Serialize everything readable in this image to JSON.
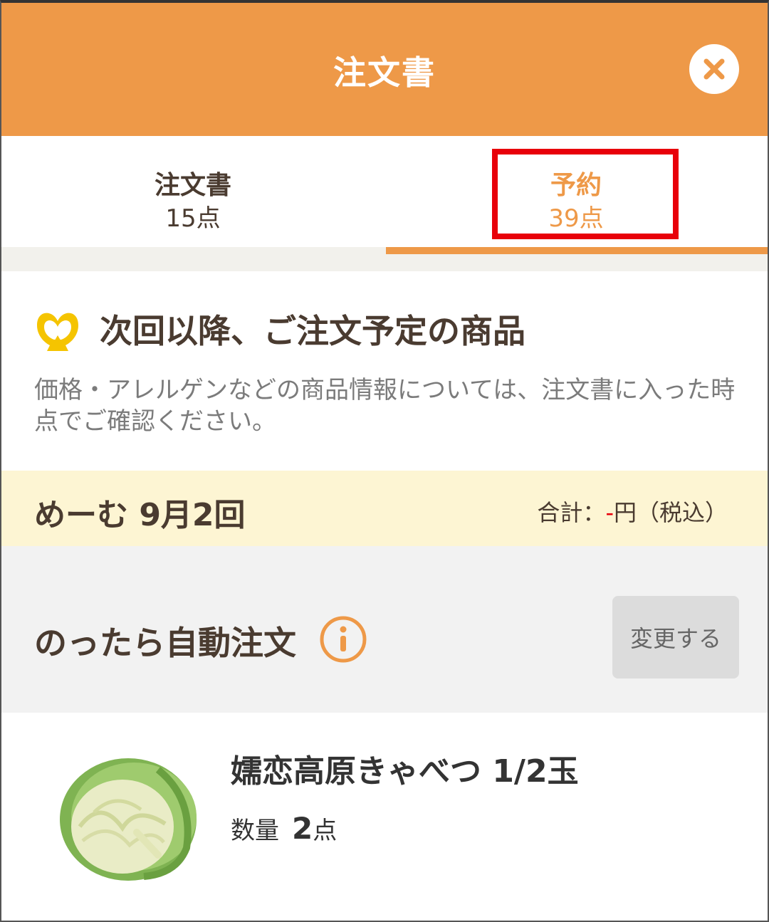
{
  "header": {
    "title": "注文書",
    "close_icon": "close-icon"
  },
  "tabs": [
    {
      "label": "注文書",
      "count": "15点"
    },
    {
      "label": "予約",
      "count": "39点"
    }
  ],
  "section": {
    "icon": "logo-icon",
    "title": "次回以降、ご注文予定の商品",
    "description": "価格・アレルゲンなどの商品情報については、注文書に入った時点でご確認ください。"
  },
  "delivery": {
    "label": "めーむ 9月2回",
    "total_prefix": "合計：",
    "total_value": "-",
    "total_suffix": "円（税込）"
  },
  "auto_order": {
    "label": "のったら自動注文",
    "info_icon": "info-icon",
    "change_label": "変更する"
  },
  "product": {
    "name": "嬬恋高原きゃべつ 1/2玉",
    "qty_label": "数量",
    "qty_value": "2",
    "qty_unit": "点"
  },
  "colors": {
    "accent": "#ee9948",
    "highlight": "#e8000a",
    "date_bg": "#fdf5d3"
  }
}
